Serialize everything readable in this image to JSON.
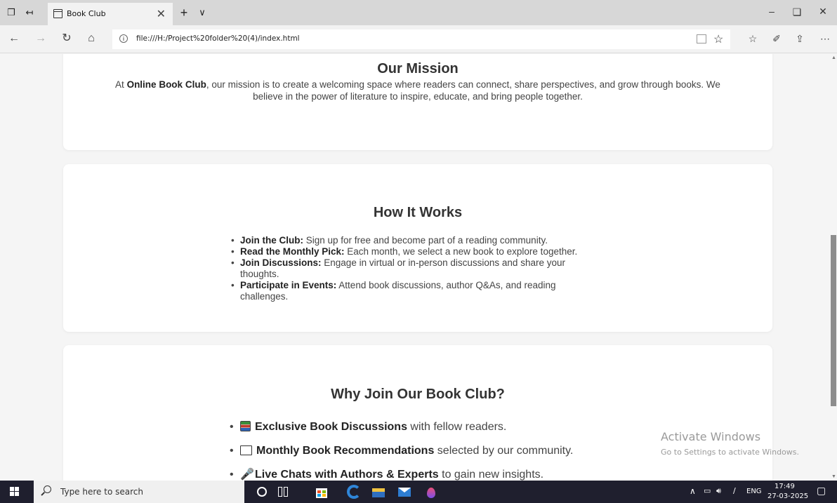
{
  "browser": {
    "tab_title": "Book Club",
    "url": "file:///H:/Project%20folder%20(4)/index.html"
  },
  "mission": {
    "heading": "Our Mission",
    "text_before": "At ",
    "club_name": "Online Book Club",
    "text_line1_after": ", our mission is to create a welcoming space where readers can connect, share perspectives, and grow through books. We",
    "text_line2": "believe in the power of literature to inspire, educate, and bring people together."
  },
  "how_it_works": {
    "heading": "How It Works",
    "items": [
      {
        "title": "Join the Club:",
        "text": " Sign up for free and become part of a reading community."
      },
      {
        "title": "Read the Monthly Pick:",
        "text": " Each month, we select a new book to explore together."
      },
      {
        "title": "Join Discussions:",
        "text": " Engage in virtual or in-person discussions and share your thoughts."
      },
      {
        "title": "Participate in Events:",
        "text": " Attend book discussions, author Q&As, and reading challenges."
      }
    ]
  },
  "why_join": {
    "heading": "Why Join Our Book Club?",
    "items": [
      {
        "icon": "books-icon",
        "title": "Exclusive Book Discussions",
        "text": " with fellow readers."
      },
      {
        "icon": "book-icon",
        "title": "Monthly Book Recommendations",
        "text": " selected by our community."
      },
      {
        "icon": "microphone-icon",
        "title": "Live Chats with Authors & Experts",
        "text": " to gain new insights."
      }
    ]
  },
  "watermark": {
    "title": "Activate Windows",
    "subtitle": "Go to Settings to activate Windows."
  },
  "taskbar": {
    "search_placeholder": "Type here to search",
    "language": "ENG",
    "time": "17:49",
    "date": "27-03-2025"
  }
}
